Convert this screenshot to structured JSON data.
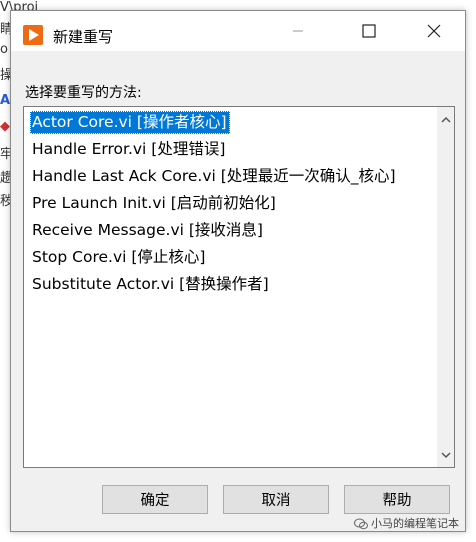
{
  "background": {
    "fragments": [
      "V\\proj",
      "睛",
      "o",
      "操",
      "Ac",
      "",
      "牢",
      "趱",
      "秽"
    ]
  },
  "dialog": {
    "title": "新建重写",
    "prompt": "选择要重写的方法:",
    "methods": [
      "Actor Core.vi [操作者核心]",
      "Handle Error.vi [处理错误]",
      "Handle Last Ack Core.vi [处理最近一次确认_核心]",
      "Pre Launch Init.vi [启动前初始化]",
      "Receive Message.vi [接收消息]",
      "Stop Core.vi [停止核心]",
      "Substitute Actor.vi [替换操作者]"
    ],
    "selected_index": 0,
    "buttons": {
      "ok": "确定",
      "cancel": "取消",
      "help": "帮助"
    }
  },
  "watermark": "小马的编程笔记本",
  "colors": {
    "selection": "#0078d7",
    "app_icon": "#ee6a14"
  }
}
